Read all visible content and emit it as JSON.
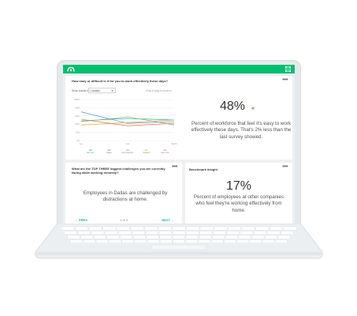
{
  "top_card": {
    "question": "How easy or difficult is it for you to work effectively these days?",
    "show_results_label": "Show results by",
    "show_results_value": "Location",
    "drag_hint": "Click & drag to zoom in",
    "big_stat": "48%",
    "trend": "down",
    "stat_text": "Percent of workforce that feel it's easy to work effectively these days. That's 2% less than the last survey showed."
  },
  "challenges_card": {
    "question": "What are the TOP THREE biggest challenges you are currently facing while working remotely?",
    "body": "Employees in Dallas are challenged by distractions at home.",
    "prev_label": "← PREV",
    "pager": "1 of 3",
    "next_label": "NEXT →"
  },
  "benchmark_card": {
    "title": "Benchmark insight",
    "big_stat": "17%",
    "stat_text": "Percent of employees at other companies who feel they're working effectively from home."
  },
  "colors": {
    "brand": "#00bf6f",
    "down_arrow": "#e86c40"
  },
  "chart_data": {
    "type": "line",
    "x": [
      "Jan",
      "Feb",
      "March"
    ],
    "ylim": [
      0,
      100
    ],
    "yticks": [
      0,
      20,
      40,
      60,
      80,
      100
    ],
    "grid": true,
    "legend": "bottom",
    "series": [
      {
        "name": "San Jose",
        "color": "#00bf6f",
        "values": [
          48,
          54,
          50
        ]
      },
      {
        "name": "Dallas",
        "color": "#4a90d9",
        "values": [
          70,
          42,
          46
        ]
      },
      {
        "name": "San Francisco",
        "color": "#9aa3ad",
        "values": [
          46,
          58,
          38
        ]
      },
      {
        "name": "Portland",
        "color": "#f2a532",
        "values": [
          38,
          44,
          50
        ]
      },
      {
        "name": "New York",
        "color": "#e8743b",
        "values": [
          52,
          36,
          42
        ]
      }
    ]
  }
}
